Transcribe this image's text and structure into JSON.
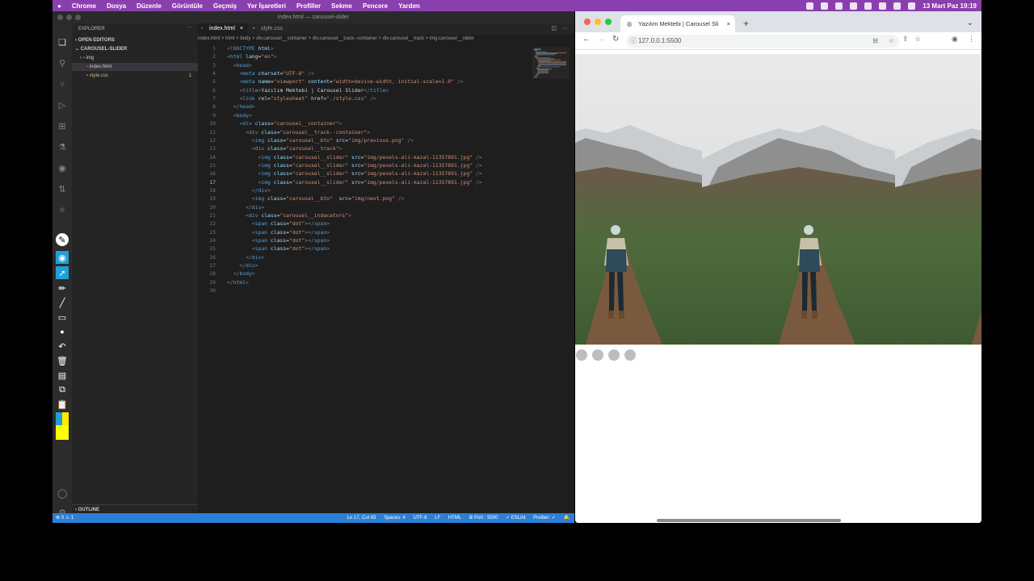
{
  "menubar": {
    "apple": "",
    "items": [
      "Chrome",
      "Dosya",
      "Düzenle",
      "Görüntüle",
      "Geçmiş",
      "Yer İşaretleri",
      "Profiller",
      "Sekme",
      "Pencere",
      "Yardım"
    ],
    "datetime": "13 Mart Paz  19:19"
  },
  "vscode": {
    "window_title": "index.html — carousel-slider",
    "explorer_title": "EXPLORER",
    "open_editors": "OPEN EDITORS",
    "project": "CAROUSEL-SLIDER",
    "folder_img": "img",
    "file_index": "index.html",
    "file_style": "style.css",
    "style_badge": "1",
    "outline": "OUTLINE",
    "tab_index": "index.html",
    "tab_style": "style.css",
    "breadcrumb": "index.html  >  html  >  body  >  div.carousel__container  >  div.carousel__track--container  >  div.carousel__track  >  img.carousel__slider",
    "status_left": "⊗ 0 ⚠ 1",
    "status_items": [
      "Ln 17, Col 83",
      "Spaces: 4",
      "UTF-8",
      "LF",
      "HTML",
      "⦾ Port : 5500",
      "✓ ESLint",
      "Prettier: ✓"
    ],
    "code_lines": [
      "<!DOCTYPE html>",
      "<html lang=\"en\">",
      "  <head>",
      "    <meta charset=\"UTF-8\" />",
      "    <meta name=\"viewport\" content=\"width=device-width, initial-scale=1.0\" />",
      "    <title>Yazılım Mektebi | Carousel Slider</title>",
      "    <link rel=\"stylesheet\" href=\"./style.css\" />",
      "  </head>",
      "  <body>",
      "    <div class=\"carousel__container\">",
      "      <div class=\"carousel__track--container\">",
      "        <img class=\"carousel__btn\" src=\"img/previous.png\" />",
      "        <div class=\"carousel__track\">",
      "          <img class=\"carousel__slider\" src=\"img/pexels-ali-kazal-11357891.jpg\" />",
      "          <img class=\"carousel__slider\" src=\"img/pexels-ali-kazal-11357891.jpg\" />",
      "          <img class=\"carousel__slider\" src=\"img/pexels-ali-kazal-11357891.jpg\" />",
      "          <img class=\"carousel__slider\" src=\"img/pexels-ali-kazal-11357891.jpg\" />",
      "        </div>",
      "        <img class=\"carousel__btn\"  src=\"img/next.png\" />",
      "      </div>",
      "      <div class=\"carousel__indacators\">",
      "        <span class=\"dot\"></span>",
      "        <span class=\"dot\"></span>",
      "        <span class=\"dot\"></span>",
      "        <span class=\"dot\"></span>",
      "      </div>",
      "    </div>",
      "  </body>",
      "</html>",
      ""
    ]
  },
  "browser": {
    "tab_title": "Yazılım Mektebi | Carousel Sli",
    "url": "127.0.0.1:5500",
    "indicator_count": 4
  },
  "colors": {
    "menubar": "#8a3fae",
    "statusbar": "#2b7fd6",
    "tag": "#569cd6",
    "attr": "#9cdcfe",
    "string": "#ce9178"
  }
}
